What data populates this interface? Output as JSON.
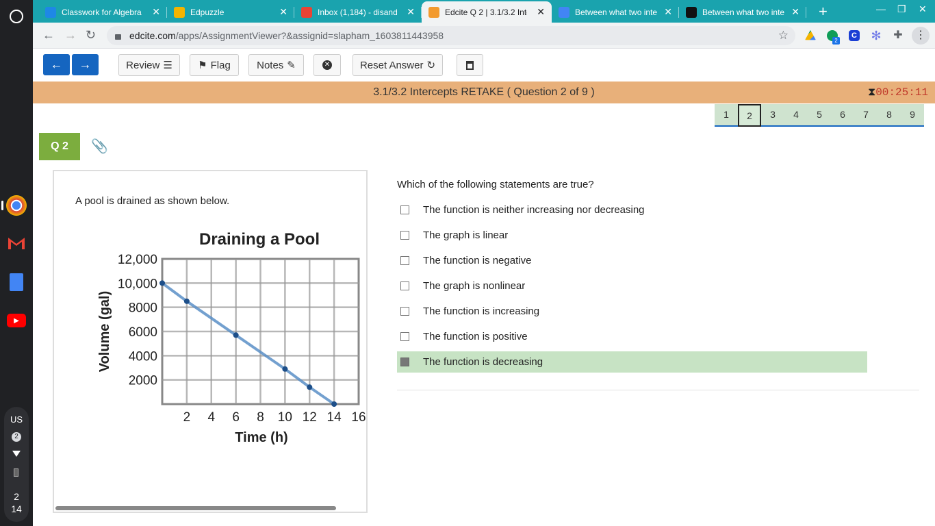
{
  "browser": {
    "tabs": [
      {
        "title": "Classwork for Algebra",
        "favicon": "classroom-icon",
        "color": "#1e88e5",
        "active": false
      },
      {
        "title": "Edpuzzle",
        "favicon": "edpuzzle-icon",
        "color": "#f4b400",
        "active": false
      },
      {
        "title": "Inbox (1,184) - disand",
        "favicon": "gmail-icon",
        "color": "#ea4335",
        "active": false
      },
      {
        "title": "Edcite Q 2 | 3.1/3.2 Inte",
        "favicon": "edcite-icon",
        "color": "#f29a2e",
        "active": true
      },
      {
        "title": "Between what two inte",
        "favicon": "google-icon",
        "color": "#4285f4",
        "active": false
      },
      {
        "title": "Between what two inte",
        "favicon": "brainly-icon",
        "color": "#111111",
        "active": false
      }
    ],
    "url_host": "edcite.com",
    "url_path": "/apps/AssignmentViewer?&assignid=slapham_1603811443958",
    "extension_badge": "2"
  },
  "shelf": {
    "lang": "US",
    "notifications": "2",
    "date_line1": "2",
    "date_line2": "14"
  },
  "toolbar": {
    "review_label": "Review",
    "flag_label": "Flag",
    "notes_label": "Notes",
    "reset_label": "Reset Answer"
  },
  "header": {
    "title": "3.1/3.2 Intercepts RETAKE ( Question 2 of 9 )",
    "timer": "00:25:11"
  },
  "question_nav": [
    "1",
    "2",
    "3",
    "4",
    "5",
    "6",
    "7",
    "8",
    "9"
  ],
  "current_question": "2",
  "question_badge": "Q 2",
  "left_pane": {
    "prompt": "A pool is drained as shown below."
  },
  "chart_data": {
    "type": "line",
    "title": "Draining a Pool",
    "xlabel": "Time (h)",
    "ylabel": "Volume (gal)",
    "x_ticks": [
      "2",
      "4",
      "6",
      "8",
      "10",
      "12",
      "14",
      "16"
    ],
    "y_ticks": [
      "12,000",
      "10,000",
      "8000",
      "6000",
      "4000",
      "2000"
    ],
    "xlim": [
      0,
      16
    ],
    "ylim": [
      0,
      12000
    ],
    "grid": true,
    "series": [
      {
        "x": [
          0,
          2,
          6,
          10,
          12,
          14
        ],
        "y": [
          10000,
          8500,
          5700,
          2900,
          1400,
          0
        ]
      }
    ]
  },
  "question": {
    "text": "Which of the following statements are true?",
    "options": [
      {
        "label": "The function is neither increasing nor decreasing",
        "checked": false
      },
      {
        "label": "The graph is linear",
        "checked": false
      },
      {
        "label": "The function is negative",
        "checked": false
      },
      {
        "label": "The graph is nonlinear",
        "checked": false
      },
      {
        "label": "The function is increasing",
        "checked": false
      },
      {
        "label": "The function is positive",
        "checked": false
      },
      {
        "label": "The function is decreasing",
        "checked": true
      }
    ]
  },
  "colors": {
    "title_bar": "#e8b07a",
    "primary_button": "#1565c0",
    "badge": "#7cad3e",
    "selected_option": "#c7e3c4"
  }
}
